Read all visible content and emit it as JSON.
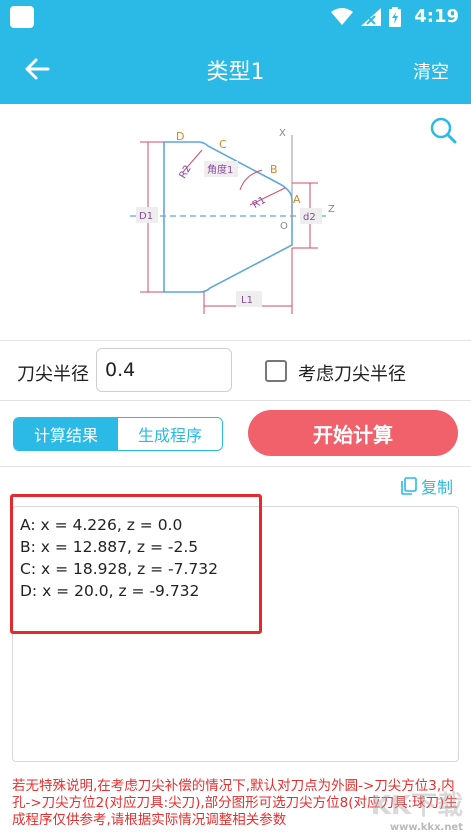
{
  "status_bar": {
    "time": "4:19"
  },
  "header": {
    "title": "类型1",
    "clear_label": "清空"
  },
  "diagram": {
    "labels": {
      "D": "D",
      "C": "C",
      "B": "B",
      "A": "A",
      "O": "O",
      "X": "X",
      "Z": "Z",
      "R1": "R1",
      "R2": "R2",
      "angle": "角度1",
      "D1": "D1",
      "d2": "d2",
      "L1": "L1"
    }
  },
  "form": {
    "radius_label": "刀尖半径",
    "radius_value": "0.4",
    "consider_label": "考虑刀尖半径",
    "consider_checked": false
  },
  "tabs": {
    "result": "计算结果",
    "program": "生成程序",
    "active": "result"
  },
  "start_button": "开始计算",
  "copy_label": "复制",
  "results": [
    "A:  x = 4.226,   z = 0.0",
    "B:  x = 12.887,   z = -2.5",
    "C:  x = 18.928,   z = -7.732",
    "D:  x = 20.0,   z = -9.732"
  ],
  "note": "若无特殊说明,在考虑刀尖补偿的情况下,默认对刀点为外圆->刀尖方位3,内孔->刀尖方位2(对应刀具:尖刀),部分图形可选刀尖方位8(对应刀具:球刀)生成程序仅供参考,请根据实际情况调整相关参数",
  "watermark": {
    "main": "KK下载",
    "sub": "www.kkx.net"
  },
  "colors": {
    "primary": "#2bb9e6",
    "accent": "#f0616b",
    "highlight": "#e6292f",
    "note": "#e62e2e"
  }
}
